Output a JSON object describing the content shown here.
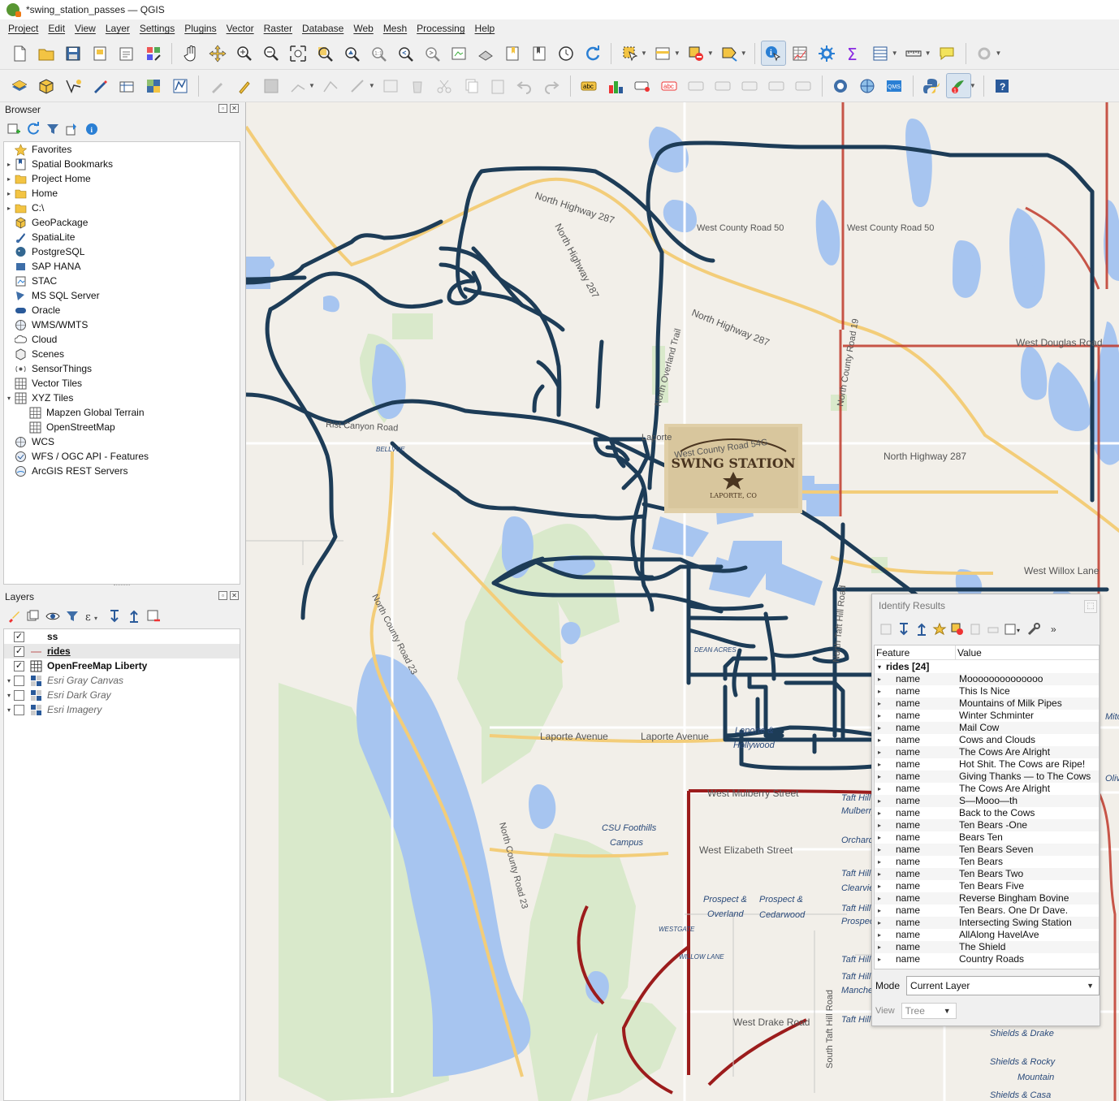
{
  "window": {
    "title": "*swing_station_passes — QGIS"
  },
  "menu": [
    "Project",
    "Edit",
    "View",
    "Layer",
    "Settings",
    "Plugins",
    "Vector",
    "Raster",
    "Database",
    "Web",
    "Mesh",
    "Processing",
    "Help"
  ],
  "browser": {
    "title": "Browser",
    "items": [
      {
        "label": "Favorites",
        "icon": "star-icon",
        "expand": ""
      },
      {
        "label": "Spatial Bookmarks",
        "icon": "bookmark-icon",
        "expand": "▸"
      },
      {
        "label": "Project Home",
        "icon": "folder-icon",
        "expand": "▸"
      },
      {
        "label": "Home",
        "icon": "folder-icon",
        "expand": "▸"
      },
      {
        "label": "C:\\",
        "icon": "drive-icon",
        "expand": "▸"
      },
      {
        "label": "GeoPackage",
        "icon": "geopackage-icon",
        "expand": ""
      },
      {
        "label": "SpatiaLite",
        "icon": "spatialite-icon",
        "expand": ""
      },
      {
        "label": "PostgreSQL",
        "icon": "postgresql-icon",
        "expand": ""
      },
      {
        "label": "SAP HANA",
        "icon": "sap-hana-icon",
        "expand": ""
      },
      {
        "label": "STAC",
        "icon": "stac-icon",
        "expand": ""
      },
      {
        "label": "MS SQL Server",
        "icon": "mssql-icon",
        "expand": ""
      },
      {
        "label": "Oracle",
        "icon": "oracle-icon",
        "expand": ""
      },
      {
        "label": "WMS/WMTS",
        "icon": "globe-icon",
        "expand": ""
      },
      {
        "label": "Cloud",
        "icon": "cloud-icon",
        "expand": ""
      },
      {
        "label": "Scenes",
        "icon": "cube-icon",
        "expand": ""
      },
      {
        "label": "SensorThings",
        "icon": "sensor-icon",
        "expand": ""
      },
      {
        "label": "Vector Tiles",
        "icon": "grid-icon",
        "expand": ""
      },
      {
        "label": "XYZ Tiles",
        "icon": "grid-icon",
        "expand": "▾"
      },
      {
        "label": "Mapzen Global Terrain",
        "icon": "grid-icon",
        "expand": "",
        "indent": true
      },
      {
        "label": "OpenStreetMap",
        "icon": "grid-icon",
        "expand": "",
        "indent": true
      },
      {
        "label": "WCS",
        "icon": "globe-icon",
        "expand": ""
      },
      {
        "label": "WFS / OGC API - Features",
        "icon": "wfs-icon",
        "expand": ""
      },
      {
        "label": "ArcGIS REST Servers",
        "icon": "arcgis-icon",
        "expand": ""
      }
    ]
  },
  "layers": {
    "title": "Layers",
    "items": [
      {
        "label": "ss",
        "checked": true,
        "expand": "",
        "style": "bold",
        "icon": "none"
      },
      {
        "label": "rides",
        "checked": true,
        "expand": "",
        "style": "bold under",
        "icon": "line-icon"
      },
      {
        "label": "OpenFreeMap Liberty",
        "checked": true,
        "expand": "",
        "style": "bold",
        "icon": "vector-tile-icon"
      },
      {
        "label": "Esri Gray Canvas",
        "checked": false,
        "expand": "▾",
        "style": "italic",
        "icon": "raster-icon"
      },
      {
        "label": "Esri Dark Gray",
        "checked": false,
        "expand": "▾",
        "style": "italic",
        "icon": "raster-icon"
      },
      {
        "label": "Esri Imagery",
        "checked": false,
        "expand": "▾",
        "style": "italic",
        "icon": "raster-icon"
      }
    ]
  },
  "map": {
    "labels": [
      "North Highway 287",
      "North Highway 287",
      "West County Road 50",
      "West County Road 50",
      "North County Road 19",
      "West Douglas Road",
      "North Highway 287",
      "North Highway 287",
      "Rist Canyon Road",
      "BELLVUE",
      "Laporte",
      "West County Road 54G",
      "West Willox Lane",
      "North County Road 23",
      "DEAN ACRES",
      "Laporte Avenue",
      "Laporte Avenue",
      "Laporte &",
      "Hollywood",
      "West Mulberry Street",
      "CSU Foothills",
      "Campus",
      "West Elizabeth Street",
      "North County Road 23",
      "Prospect &",
      "Overland",
      "Prospect &",
      "Cedarwood",
      "WESTGATE",
      "WILLOW LANE",
      "West Drake Road",
      "South Taft Hill Road",
      "Shields & Drake",
      "Shields & Rocky",
      "Mountain",
      "Shields & Casa",
      "North Overland Trail",
      "North Taft Hill Road",
      "Taft Hill",
      "Mulberry",
      "Orchard",
      "Taft Hill",
      "Clearview",
      "Taft Hill",
      "Prospect",
      "Taft Hill",
      "Taft Hill",
      "Manchester",
      "Taft Hill",
      "Olive",
      "Mitchell"
    ],
    "logo": {
      "line1": "SWING STATION",
      "line2": "LAPORTE, CO"
    },
    "colors": {
      "ride": "#1d3c57",
      "water": "#a6c4ef",
      "park": "#d7e8c8",
      "road_major": "#c23b3b",
      "road": "#f3cd79"
    }
  },
  "identify": {
    "title": "Identify Results",
    "col_feature": "Feature",
    "col_value": "Value",
    "group": "rides  [24]",
    "rows": [
      {
        "k": "name",
        "v": "Moooooooooooooo"
      },
      {
        "k": "name",
        "v": "This Is Nice"
      },
      {
        "k": "name",
        "v": "Mountains of Milk Pipes"
      },
      {
        "k": "name",
        "v": "Winter Schminter"
      },
      {
        "k": "name",
        "v": "Mail Cow"
      },
      {
        "k": "name",
        "v": "Cows and Clouds"
      },
      {
        "k": "name",
        "v": "The Cows Are Alright"
      },
      {
        "k": "name",
        "v": "Hot Shit. The Cows are Ripe!"
      },
      {
        "k": "name",
        "v": "Giving Thanks — to The Cows"
      },
      {
        "k": "name",
        "v": "The Cows Are Alright"
      },
      {
        "k": "name",
        "v": "S—Mooo—th"
      },
      {
        "k": "name",
        "v": "Back to the Cows"
      },
      {
        "k": "name",
        "v": "Ten Bears -One"
      },
      {
        "k": "name",
        "v": "Bears Ten"
      },
      {
        "k": "name",
        "v": "Ten Bears Seven"
      },
      {
        "k": "name",
        "v": "Ten Bears"
      },
      {
        "k": "name",
        "v": "Ten Bears Two"
      },
      {
        "k": "name",
        "v": "Ten Bears Five"
      },
      {
        "k": "name",
        "v": "Reverse Bingham Bovine"
      },
      {
        "k": "name",
        "v": "Ten Bears. One Dr Dave."
      },
      {
        "k": "name",
        "v": "Intersecting Swing Station"
      },
      {
        "k": "name",
        "v": "AllAlong HavelAve"
      },
      {
        "k": "name",
        "v": "The Shield"
      },
      {
        "k": "name",
        "v": "Country Roads"
      }
    ],
    "mode_label": "Mode",
    "mode_value": "Current Layer",
    "view_label": "View",
    "view_value": "Tree"
  }
}
